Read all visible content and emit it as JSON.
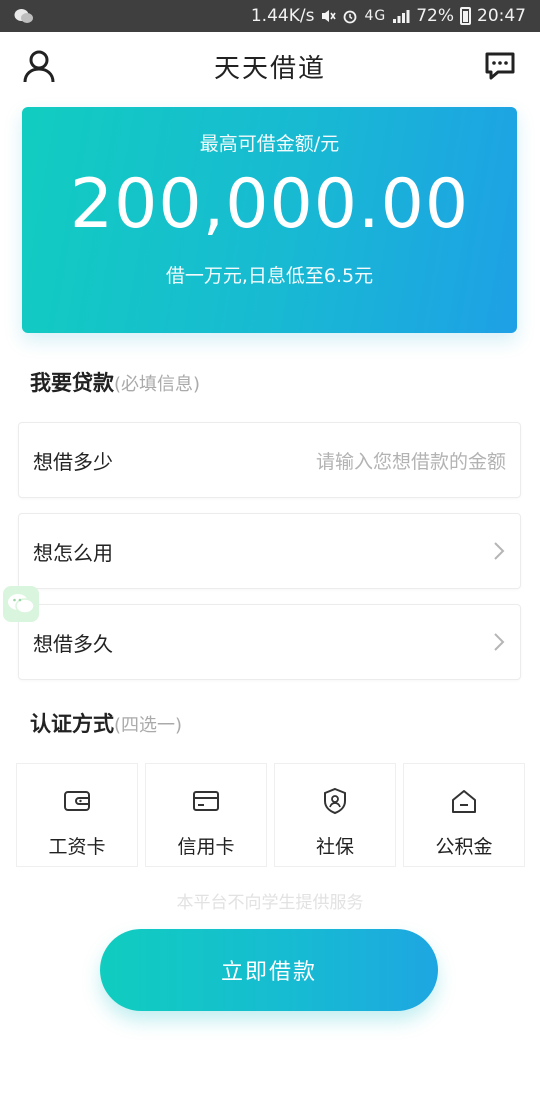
{
  "status_bar": {
    "speed": "1.44K/s",
    "network": "4G",
    "battery": "72%",
    "time": "20:47"
  },
  "header": {
    "title": "天天借道"
  },
  "banner": {
    "label": "最高可借金额/元",
    "amount": "200,000.00",
    "sub": "借一万元,日息低至6.5元"
  },
  "loan_section": {
    "title": "我要贷款",
    "hint": "(必填信息)",
    "rows": [
      {
        "label": "想借多少",
        "placeholder": "请输入您想借款的金额"
      },
      {
        "label": "想怎么用"
      },
      {
        "label": "想借多久"
      }
    ]
  },
  "auth_section": {
    "title": "认证方式",
    "hint": "(四选一)",
    "cards": [
      {
        "label": "工资卡",
        "icon": "wallet-icon"
      },
      {
        "label": "信用卡",
        "icon": "credit-card-icon"
      },
      {
        "label": "社保",
        "icon": "shield-user-icon"
      },
      {
        "label": "公积金",
        "icon": "house-icon"
      }
    ]
  },
  "notice": "本平台不向学生提供服务",
  "submit_label": "立即借款",
  "colors": {
    "accent_start": "#11cdc0",
    "accent_end": "#1ea0e6"
  }
}
